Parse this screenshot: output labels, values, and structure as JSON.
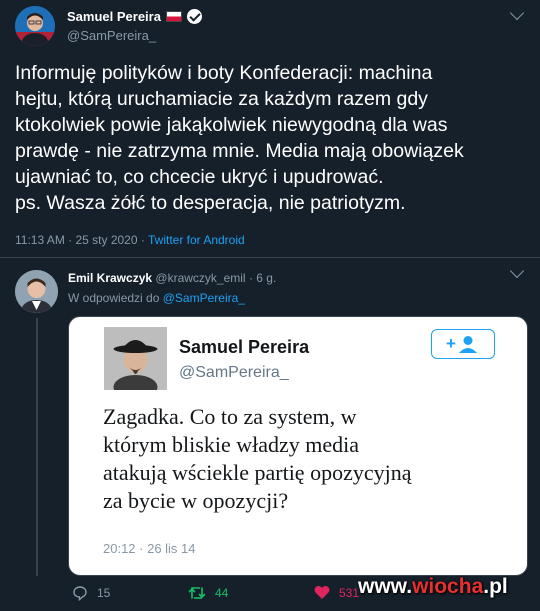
{
  "main_tweet": {
    "author_name": "Samuel Pereira",
    "handle": "@SamPereira_",
    "text_lines": [
      "Informuję polityków i boty Konfederacji: machina",
      "hejtu, którą uruchamiacie za każdym razem gdy",
      "ktokolwiek powie jakąkolwiek niewygodną dla was",
      "prawdę - nie zatrzyma mnie. Media mają obowiązek",
      "ujawniać to, co chcecie ukryć i upudrować.",
      "ps. Wasza żółć to desperacja, nie patriotyzm."
    ],
    "time": "11:13 AM · 25 sty 2020",
    "separator": " · ",
    "source": "Twitter for Android"
  },
  "reply_tweet": {
    "author_name": "Emil Krawczyk",
    "handle": "@krawczyk_emil",
    "age": "· 6 g.",
    "reply_prefix": "W odpowiedzi do",
    "reply_to": "@SamPereira_",
    "embedded": {
      "author_name": "Samuel Pereira",
      "handle": "@SamPereira_",
      "text_lines": [
        "Zagadka. Co to za system, w",
        "którym bliskie władzy media",
        "atakują wściekle partię opozycyjną",
        "za bycie w opozycji?"
      ],
      "date": "20:12 · 26 lis 14"
    },
    "actions": {
      "replies": "15",
      "retweets": "44",
      "likes": "531"
    }
  },
  "watermark": {
    "prefix": "www.",
    "accent": "wiocha",
    "suffix": ".pl"
  },
  "colors": {
    "background": "#15202b",
    "link": "#1da1f2",
    "retweet": "#17bf63",
    "like": "#e0245e"
  },
  "icons": [
    "chevron-down-icon",
    "verified-icon",
    "poland-flag-icon",
    "reply-icon",
    "retweet-icon",
    "heart-icon",
    "follow-icon"
  ]
}
